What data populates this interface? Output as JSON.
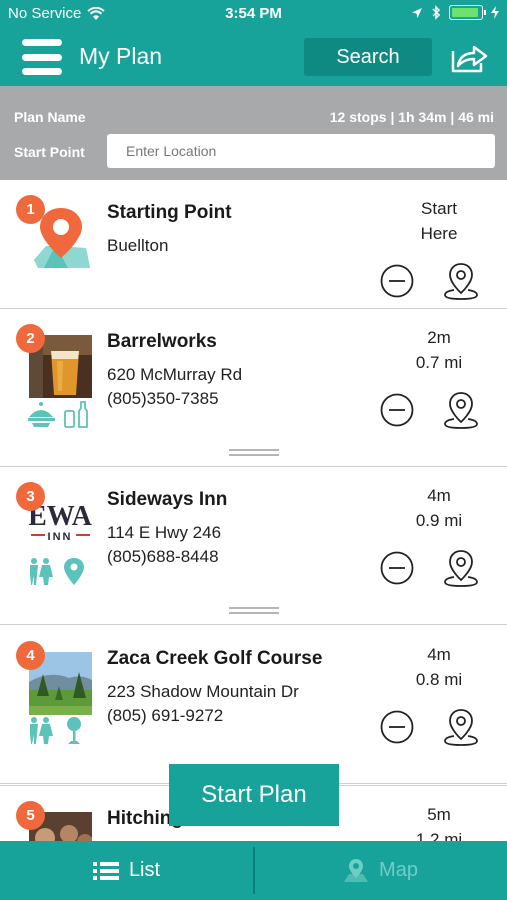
{
  "status_bar": {
    "carrier": "No Service",
    "time": "3:54 PM"
  },
  "header": {
    "title": "My Plan",
    "search_label": "Search",
    "menu_icon": "hamburger-menu-icon",
    "share_icon": "share-icon"
  },
  "plan_bar": {
    "plan_name_label": "Plan Name",
    "summary": "12 stops | 1h 34m | 46 mi",
    "start_point_label": "Start Point",
    "start_point_placeholder": "Enter Location",
    "start_point_value": ""
  },
  "stops": [
    {
      "number": "1",
      "name": "Starting Point",
      "address": "Buellton",
      "phone": "",
      "time_line1": "Start",
      "time_line2": "Here",
      "categories": []
    },
    {
      "number": "2",
      "name": "Barrelworks",
      "address": "620 McMurray Rd",
      "phone": "(805)350-7385",
      "time_line1": "2m",
      "time_line2": "0.7 mi",
      "categories": [
        "dining-icon",
        "drinks-icon"
      ]
    },
    {
      "number": "3",
      "name": "Sideways Inn",
      "address": "114 E Hwy 246",
      "phone": "(805)688-8448",
      "time_line1": "4m",
      "time_line2": "0.9 mi",
      "categories": [
        "family-icon",
        "location-icon"
      ],
      "thumb_text": "EWA",
      "thumb_subtext": "INN"
    },
    {
      "number": "4",
      "name": "Zaca Creek Golf Course",
      "address": "223 Shadow Mountain Dr",
      "phone": "(805) 691-9272",
      "time_line1": "4m",
      "time_line2": "0.8 mi",
      "categories": [
        "family-icon",
        "golf-icon"
      ]
    },
    {
      "number": "5",
      "name": "Hitching",
      "address": "",
      "phone": "",
      "time_line1": "5m",
      "time_line2": "1.2 mi",
      "categories": []
    }
  ],
  "start_plan_label": "Start Plan",
  "tabs": {
    "list_label": "List",
    "map_label": "Map"
  },
  "colors": {
    "brand_teal": "#17a39a",
    "badge_orange": "#f0693c",
    "plan_bar_gray": "#a7a9ab"
  }
}
